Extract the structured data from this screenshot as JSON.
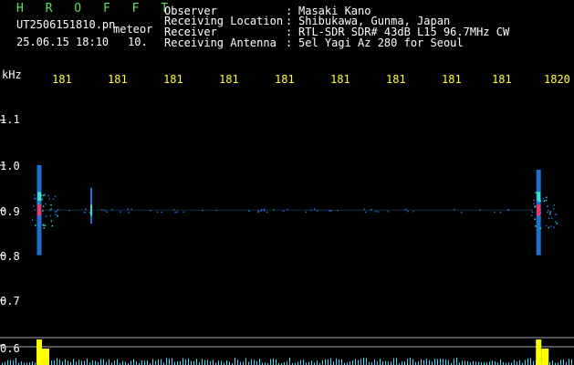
{
  "header": {
    "brand": "H R O F F T",
    "filename": "UT2506151810.pn",
    "mode": "meteor",
    "datetime": "25.06.15 18:10",
    "interval": "10.",
    "fields": [
      {
        "label": "Observer",
        "value": "Masaki Kano"
      },
      {
        "label": "Receiving Location",
        "value": "Shibukawa, Gunma, Japan"
      },
      {
        "label": "Receiver",
        "value": "RTL-SDR SDR# 43dB L15 96.7MHz CW"
      },
      {
        "label": "Receiving Antenna",
        "value": "5el Yagi Az 280 for Seoul"
      }
    ],
    "separator": ":"
  },
  "chart_data": {
    "type": "heatmap",
    "ylabel": "kHz",
    "y_ticks": [
      "1.1",
      "1.0",
      "0.9",
      "0.8",
      "0.7",
      "0.6"
    ],
    "ylim": [
      0.57,
      1.15
    ],
    "x_ticks": [
      "181",
      "181",
      "181",
      "181",
      "181",
      "181",
      "181",
      "181",
      "181",
      "1820"
    ],
    "x_ticks_note": "time minute labels, final digits cropped except last",
    "signal_freq_khz": 0.9,
    "events": [
      {
        "t": 0.0,
        "freq": 0.9,
        "strength": 1.0,
        "span": [
          0.8,
          1.0
        ]
      },
      {
        "t": 1.0,
        "freq": 0.9,
        "strength": 0.4,
        "span": [
          0.87,
          0.95
        ]
      },
      {
        "t": 9.6,
        "freq": 0.9,
        "strength": 1.0,
        "span": [
          0.8,
          0.99
        ]
      }
    ],
    "colors": {
      "background": "#000000",
      "trace": "#1f6fd1",
      "core": "#ff3366",
      "halo": "#37e0d0",
      "spectrum_peak": "#ffff00",
      "spectrum_base": "#37e0ff",
      "axis_text": "#ffffff",
      "tick_text": "#ffff33",
      "brand": "#5fe15f"
    }
  }
}
